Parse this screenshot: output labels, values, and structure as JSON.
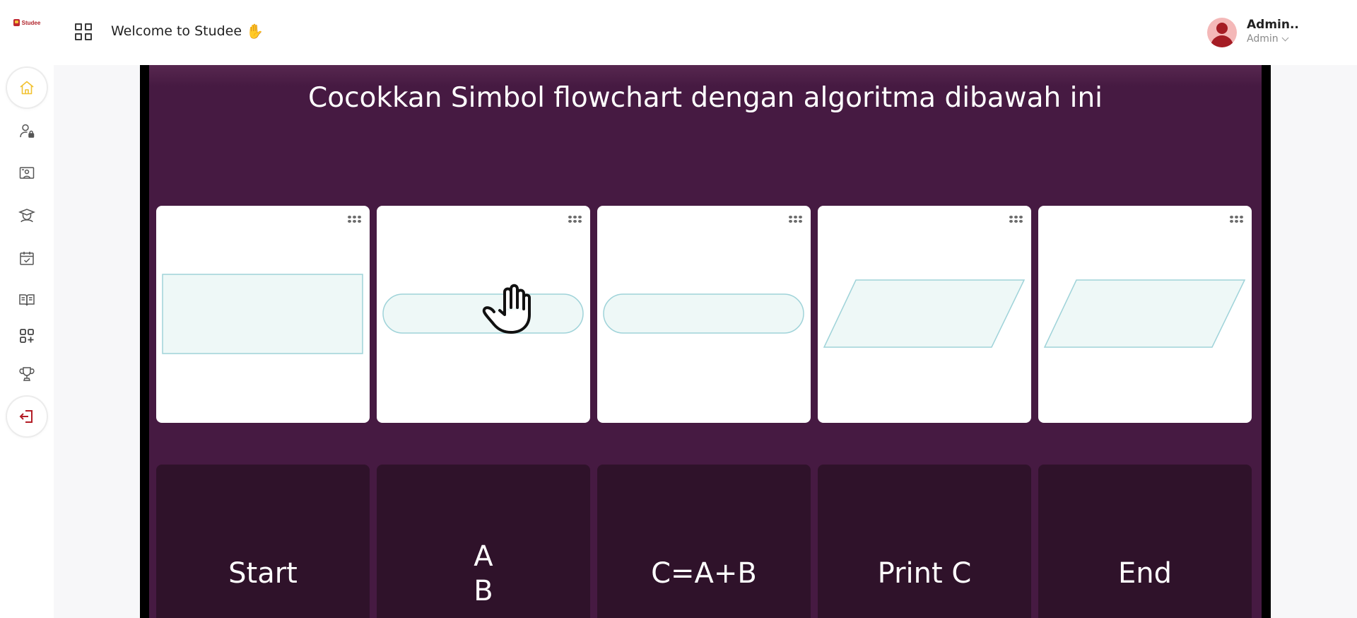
{
  "app": {
    "logo_text": "Studee",
    "welcome_text": "Welcome to Studee",
    "wave_emoji": "✋"
  },
  "user": {
    "name": "Admin..",
    "role": "Admin"
  },
  "sidebar": {
    "items": [
      {
        "name": "home",
        "icon": "home-icon",
        "active": true
      },
      {
        "name": "admin-users",
        "icon": "user-lock-icon"
      },
      {
        "name": "classroom",
        "icon": "classroom-icon"
      },
      {
        "name": "students",
        "icon": "graduate-icon"
      },
      {
        "name": "schedule",
        "icon": "calendar-check-icon"
      },
      {
        "name": "lessons",
        "icon": "book-open-icon"
      },
      {
        "name": "add-module",
        "icon": "grid-plus-icon"
      },
      {
        "name": "achievements",
        "icon": "trophy-icon"
      },
      {
        "name": "logout",
        "icon": "logout-icon"
      }
    ]
  },
  "game": {
    "title": "Cocokkan Simbol flowchart dengan algoritma dibawah ini",
    "shapes": [
      {
        "shape": "rectangle"
      },
      {
        "shape": "terminator"
      },
      {
        "shape": "terminator"
      },
      {
        "shape": "parallelogram"
      },
      {
        "shape": "parallelogram"
      }
    ],
    "answers": [
      "Start",
      "A\nB",
      "C=A+B",
      "Print C",
      "End"
    ]
  },
  "colors": {
    "game_bg": "#461a42",
    "answer_bg": "#2f122a",
    "shape_fill": "#eef8f7",
    "shape_stroke": "#9fd3d9",
    "active_icon": "#f2c230"
  }
}
